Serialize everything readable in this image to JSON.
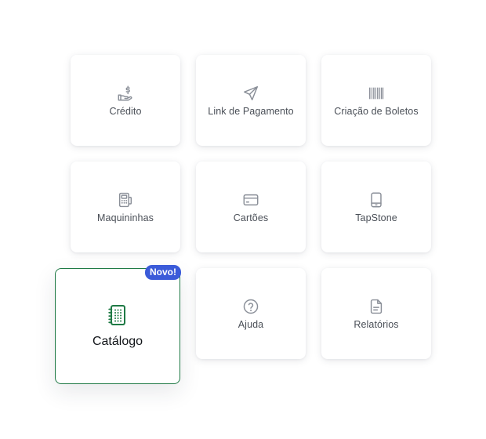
{
  "colors": {
    "icon_gray": "#8a8f98",
    "label_gray": "#4a4f57",
    "accent_green": "#1f7a45",
    "badge_blue": "#3b5bd9"
  },
  "tiles": [
    {
      "label": "Crédito",
      "icon": "hand-coin-icon"
    },
    {
      "label": "Link de Pagamento",
      "icon": "paper-plane-icon"
    },
    {
      "label": "Criação de Boletos",
      "icon": "barcode-icon"
    },
    {
      "label": "Maquininhas",
      "icon": "card-machine-icon"
    },
    {
      "label": "Cartões",
      "icon": "credit-card-icon"
    },
    {
      "label": "TapStone",
      "icon": "smartphone-icon"
    },
    {
      "label": "Ajuda",
      "icon": "help-circle-icon"
    },
    {
      "label": "Relatórios",
      "icon": "document-icon"
    }
  ],
  "featured": {
    "label": "Catálogo",
    "badge": "Novo!",
    "icon": "catalog-notebook-icon"
  }
}
